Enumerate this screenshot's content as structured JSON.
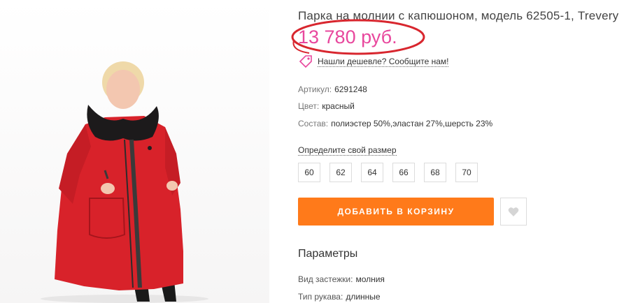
{
  "product": {
    "title": "Парка на молнии с капюшоном, модель 62505-1, Trevery",
    "price": "13 780 руб.",
    "cheaper_link": "Нашли дешевле? Сообщите нам!"
  },
  "attributes": [
    {
      "key": "Артикул:",
      "value": "6291248"
    },
    {
      "key": "Цвет:",
      "value": "красный"
    },
    {
      "key": "Состав:",
      "value": "полиэстер 50%,эластан 27%,шерсть 23%"
    }
  ],
  "size_picker": {
    "label": "Определите свой размер",
    "sizes": [
      "60",
      "62",
      "64",
      "66",
      "68",
      "70"
    ]
  },
  "actions": {
    "add_to_cart": "ДОБАВИТЬ В КОРЗИНУ",
    "wishlist_icon": "heart-icon"
  },
  "parameters": {
    "title": "Параметры",
    "rows": [
      {
        "key": "Вид застежки:",
        "value": "молния"
      },
      {
        "key": "Тип рукава:",
        "value": "длинные"
      }
    ]
  },
  "colors": {
    "price": "#e8479d",
    "price_annotation_circle": "#d8262e",
    "cart_button": "#ff7a1a",
    "product_coat": "#d8222a"
  }
}
